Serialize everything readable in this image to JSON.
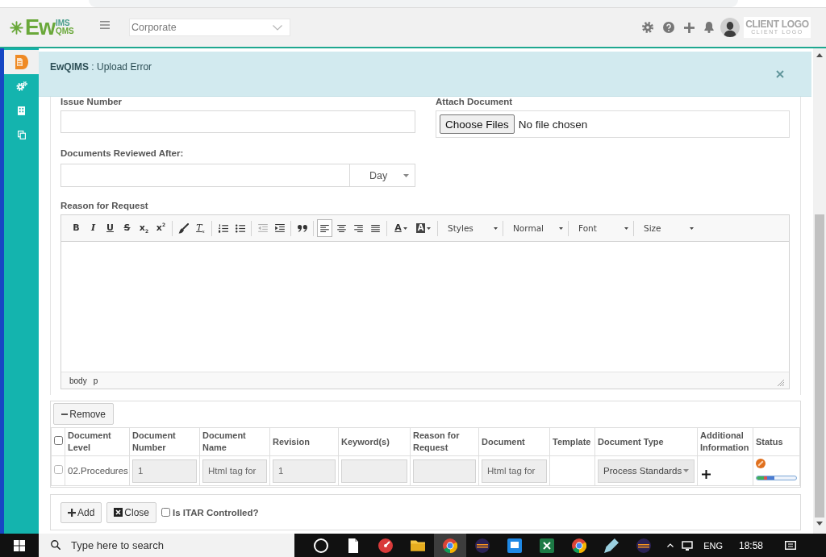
{
  "header": {
    "logo": {
      "main": "Ew",
      "top": "IMS",
      "bottom": "QMS"
    },
    "site_select": {
      "value": "Corporate"
    },
    "client_logo": {
      "title": "CLIENT LOGO",
      "subtitle": "CLIENT LOGO"
    }
  },
  "sidebar": {
    "items": [
      {
        "kind": "document",
        "selected": true
      },
      {
        "kind": "gears",
        "selected": false
      },
      {
        "kind": "building",
        "selected": false
      },
      {
        "kind": "copy",
        "selected": false
      }
    ]
  },
  "alert": {
    "message": "**EwQIMS** : Upload Error"
  },
  "form": {
    "issue_number": {
      "label": "Issue Number"
    },
    "attach_document": {
      "label": "Attach Document",
      "button": "Choose Files",
      "status": "No file chosen"
    },
    "reviewed_after": {
      "label": "Documents Reviewed After:",
      "unit": "Day"
    },
    "reason": {
      "label": "Reason for Request",
      "toolbar": [
        [
          {
            "kind": "bold",
            "label": "B",
            "selected": false,
            "disabled": false
          },
          {
            "kind": "italic",
            "label": "I",
            "selected": false,
            "disabled": false
          },
          {
            "kind": "underline",
            "label": "U",
            "selected": false,
            "disabled": false
          },
          {
            "kind": "strike",
            "label": "S",
            "selected": false,
            "disabled": false
          },
          {
            "kind": "subscript",
            "label": "x$_{2}$",
            "selected": false,
            "disabled": false
          },
          {
            "kind": "superscript",
            "label": "x$^{2}$",
            "selected": false,
            "disabled": false
          }
        ],
        [
          {
            "kind": "brush",
            "selected": false,
            "disabled": false
          },
          {
            "kind": "clear-format",
            "label": "T$_{x}$",
            "selected": false,
            "disabled": false
          }
        ],
        [
          {
            "kind": "ordered-list",
            "selected": false,
            "disabled": false
          },
          {
            "kind": "bullet-list",
            "selected": false,
            "disabled": false
          }
        ],
        [
          {
            "kind": "outdent",
            "selected": false,
            "disabled": true
          },
          {
            "kind": "indent",
            "selected": false,
            "disabled": false
          }
        ],
        [
          {
            "kind": "quote",
            "selected": false,
            "disabled": false
          }
        ],
        [
          {
            "kind": "align-left",
            "selected": true,
            "disabled": false
          },
          {
            "kind": "align-center",
            "selected": false,
            "disabled": false
          },
          {
            "kind": "align-right",
            "selected": false,
            "disabled": false
          },
          {
            "kind": "justify",
            "selected": false,
            "disabled": false
          }
        ],
        [
          {
            "kind": "text-color",
            "label": "A",
            "selected": false,
            "disabled": false
          },
          {
            "kind": "bg-color",
            "label": "A",
            "selected": false,
            "disabled": false
          }
        ]
      ],
      "combos": [
        "Styles",
        "Normal",
        "Font",
        "Size"
      ],
      "path": [
        "body",
        "p"
      ]
    }
  },
  "documents": {
    "remove_button": "Remove",
    "select_all": {
      "checked": false
    },
    "columns": [
      "Document Level",
      "Document Number",
      "Document Name",
      "Revision",
      "Keyword(s)",
      "Reason for Request",
      "Document",
      "Template",
      "Document Type",
      "Additional Information",
      "Status"
    ],
    "rows": [
      {
        "checked": false,
        "document_level": "02.Procedures",
        "document_number": "1",
        "document_name": "Html tag for",
        "revision": "1",
        "document": "Html tag for",
        "document_type": "Process Standards",
        "progress": {
          "level": 0.45
        }
      }
    ]
  },
  "actions": {
    "add_button": "Add",
    "close_button": "Close",
    "itar": {
      "label": "Is ITAR Controlled?",
      "checked": false
    }
  },
  "taskbar": {
    "search": {
      "placeholder": "Type here to search"
    },
    "apps": [
      {
        "kind": "ring",
        "selected": false
      },
      {
        "kind": "file",
        "selected": false
      },
      {
        "kind": "dial",
        "selected": false
      },
      {
        "kind": "folder",
        "selected": false
      },
      {
        "kind": "wheel",
        "selected": true
      },
      {
        "kind": "orb",
        "selected": false
      },
      {
        "kind": "panel",
        "selected": false
      },
      {
        "kind": "sheet",
        "selected": false
      },
      {
        "kind": "wheel",
        "selected": false
      },
      {
        "kind": "pen",
        "selected": false
      },
      {
        "kind": "orb",
        "selected": false
      }
    ],
    "language": "ENG",
    "time": "18:58"
  }
}
